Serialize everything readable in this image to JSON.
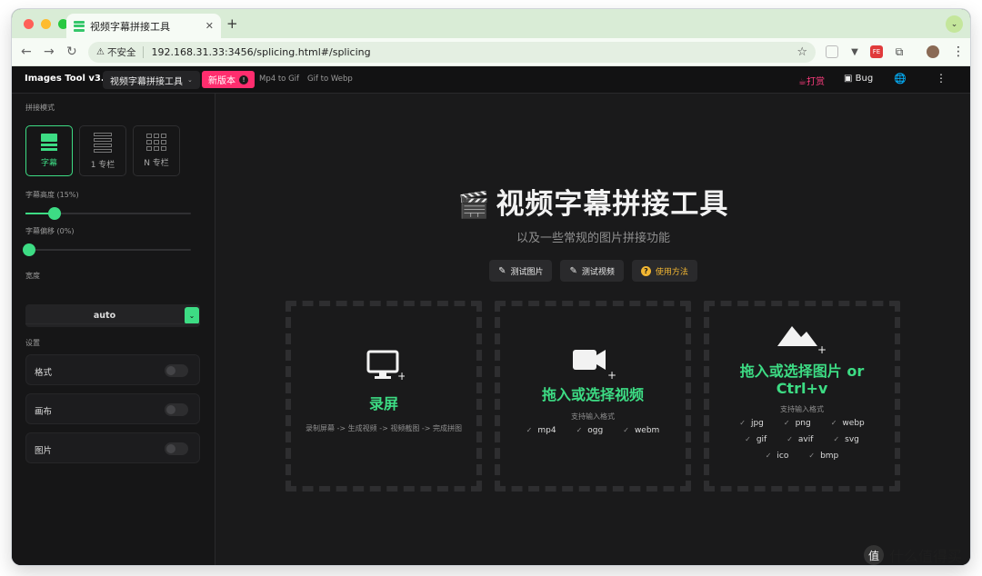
{
  "browser": {
    "tab_title": "视频字幕拼接工具",
    "tab_close": "✕",
    "new_tab": "+",
    "nav_back": "←",
    "nav_forward": "→",
    "nav_reload": "↻",
    "security_label": "不安全",
    "url": "192.168.31.33:3456/splicing.html#/splicing",
    "star": "☆",
    "menu": "⋮"
  },
  "app": {
    "brand": "Images Tool v3.0",
    "tool_selector": "视频字幕拼接工具",
    "new_version": "新版本",
    "nav_links": [
      "Mp4 to Gif",
      "Gif to Webp"
    ],
    "donate": "打赏",
    "bug": "Bug",
    "more": "⋮"
  },
  "sidebar": {
    "splice_mode_label": "拼接模式",
    "modes": [
      {
        "label": "字幕",
        "active": true
      },
      {
        "label": "1 专栏",
        "active": false
      },
      {
        "label": "N 专栏",
        "active": false
      }
    ],
    "subtitle_height_label": "字幕高度 (15%)",
    "subtitle_height_value": 15,
    "subtitle_offset_label": "字幕偏移 (0%)",
    "subtitle_offset_value": 0,
    "width_label": "宽度",
    "width_value": "auto",
    "settings_label": "设置",
    "settings": [
      {
        "label": "格式",
        "enabled": false
      },
      {
        "label": "画布",
        "enabled": false
      },
      {
        "label": "图片",
        "enabled": false
      }
    ]
  },
  "main": {
    "title": "视频字幕拼接工具",
    "subtitle": "以及一些常规的图片拼接功能",
    "actions": [
      {
        "label": "测试图片",
        "icon": "pencil-icon"
      },
      {
        "label": "测试视频",
        "icon": "pencil-icon"
      },
      {
        "label": "使用方法",
        "icon": "help-icon"
      }
    ],
    "cards": [
      {
        "title": "录屏",
        "note": "录制屏幕 -> 生成视频 -> 视频截图 -> 完成拼图",
        "icon": "monitor-icon"
      },
      {
        "title": "拖入或选择视频",
        "note": "支持输入格式",
        "icon": "video-camera-icon",
        "formats": [
          "mp4",
          "ogg",
          "webm"
        ]
      },
      {
        "title": "拖入或选择图片 or Ctrl+v",
        "note": "支持输入格式",
        "icon": "mountain-icon",
        "formats": [
          "jpg",
          "png",
          "webp",
          "gif",
          "avif",
          "svg",
          "ico",
          "bmp"
        ]
      }
    ]
  },
  "watermark": "什么值得买",
  "colors": {
    "accent": "#3ddc84",
    "new_badge": "#ff2d6e",
    "help": "#f2b632"
  }
}
